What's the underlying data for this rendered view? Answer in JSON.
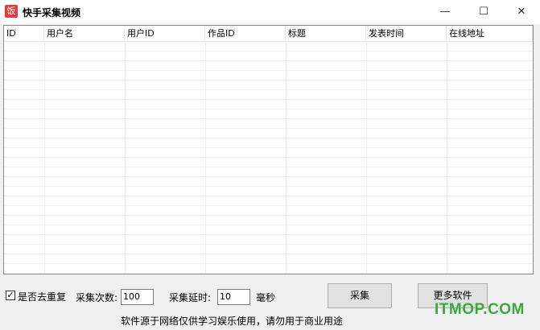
{
  "window": {
    "title": "快手采集视频",
    "icon_glyph": "饭",
    "minimize": "—",
    "maximize": "☐",
    "close": "✕"
  },
  "table": {
    "columns": [
      "ID",
      "用户名",
      "用户ID",
      "作品ID",
      "标题",
      "发表时间",
      "在线地址"
    ],
    "rows": []
  },
  "controls": {
    "dedupe_checked": true,
    "dedupe_label": "是否去重复",
    "count_label": "采集次数:",
    "count_value": "100",
    "delay_label": "采集延时:",
    "delay_value": "10",
    "delay_unit": "毫秒",
    "collect_button": "采集",
    "more_button": "更多软件",
    "checkmark": "✓"
  },
  "notice": "软件源于网络仅供学习娱乐使用，请勿用于商业用途",
  "watermark": "ITMOP.COM"
}
